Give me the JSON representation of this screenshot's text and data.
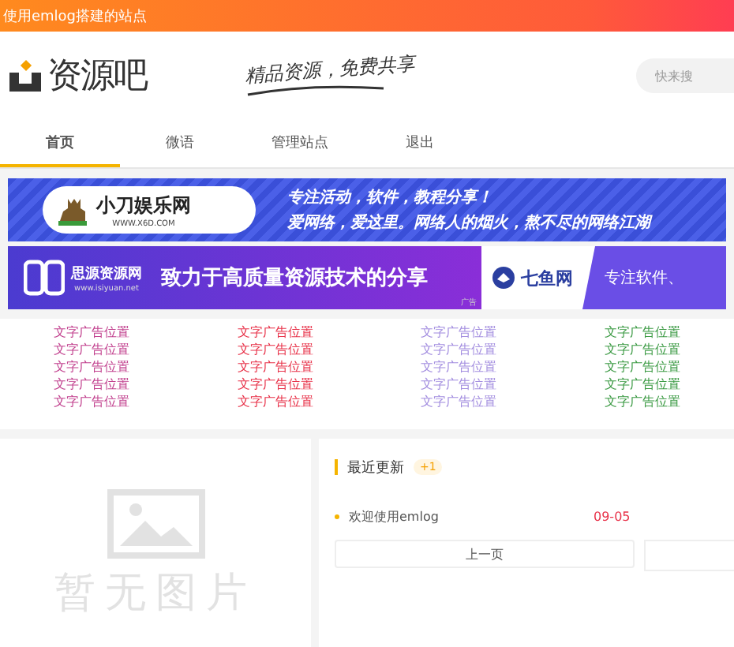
{
  "top_bar": {
    "text": "使用emlog搭建的站点"
  },
  "header": {
    "logo": "资源吧",
    "slogan": "精品资源，免费共享",
    "search": {
      "placeholder": "快来搜"
    }
  },
  "nav": [
    {
      "label": "首页",
      "selected": true
    },
    {
      "label": "微语",
      "selected": false
    },
    {
      "label": "管理站点",
      "selected": false
    },
    {
      "label": "退出",
      "selected": false
    }
  ],
  "banners": [
    {
      "kind": "single",
      "brand": "小刀娱乐网",
      "url": "WWW.X6D.COM",
      "lines": [
        "专注活动，软件，教程分享！",
        "爱网络，爱这里。网络人的烟火，熬不尽的网络江湖"
      ]
    },
    {
      "kind": "split",
      "brand": "思源资源网",
      "url": "www.isiyuan.net",
      "slogan": "致力于高质量资源技术的分享",
      "tag": "广告",
      "brand2": "七鱼网",
      "slogan2": "专注软件、"
    }
  ],
  "text_ads": [
    {
      "color": "#c2428f",
      "items": [
        "文字广告位置",
        "文字广告位置",
        "文字广告位置",
        "文字广告位置",
        "文字广告位置"
      ]
    },
    {
      "color": "#e8334a",
      "items": [
        "文字广告位置",
        "文字广告位置",
        "文字广告位置",
        "文字广告位置",
        "文字广告位置"
      ]
    },
    {
      "color": "#a48fe0",
      "items": [
        "文字广告位置",
        "文字广告位置",
        "文字广告位置",
        "文字广告位置",
        "文字广告位置"
      ]
    },
    {
      "color": "#3d9b45",
      "items": [
        "文字广告位置",
        "文字广告位置",
        "文字广告位置",
        "文字广告位置",
        "文字广告位置"
      ]
    }
  ],
  "image_panel": {
    "caption": "暂无图片"
  },
  "recent": {
    "title": "最近更新",
    "badge": "+1",
    "items": [
      {
        "title": "欢迎使用emlog",
        "date": "09-05"
      }
    ],
    "buttons": [
      "上一页"
    ]
  }
}
